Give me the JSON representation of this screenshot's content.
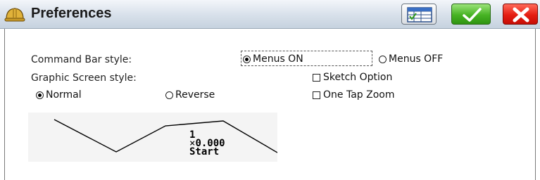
{
  "window": {
    "title": "Preferences",
    "app_icon": "hard-hat-icon",
    "buttons": {
      "calc_icon": "calculator-icon",
      "ok_icon": "checkmark-icon",
      "cancel_icon": "close-x-icon"
    },
    "colors": {
      "ok": "#47b324",
      "cancel": "#e51e12"
    }
  },
  "command_bar": {
    "label": "Command Bar style:",
    "options": [
      {
        "label": "Menus ON",
        "selected": true
      },
      {
        "label": "Menus OFF",
        "selected": false
      }
    ]
  },
  "graphic_screen": {
    "label": "Graphic Screen style:",
    "options": [
      {
        "label": "Normal",
        "selected": true
      },
      {
        "label": "Reverse",
        "selected": false
      }
    ]
  },
  "checkboxes": [
    {
      "label": "Sketch Option",
      "checked": false
    },
    {
      "label": "One Tap Zoom",
      "checked": false
    }
  ],
  "preview": {
    "line1": "1",
    "line2": "0.000",
    "line2_prefix": "×",
    "line3": "Start"
  }
}
